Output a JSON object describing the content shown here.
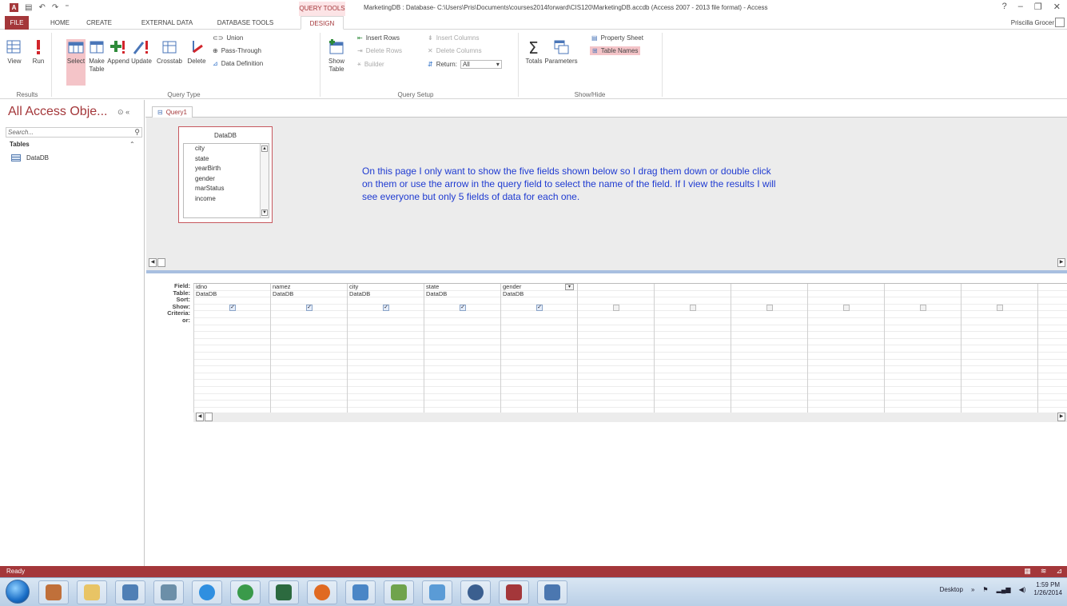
{
  "app": {
    "window_title": "MarketingDB : Database- C:\\Users\\Pris\\Documents\\courses2014forward\\CIS120\\MarketingDB.accdb (Access 2007 - 2013 file format) - Access",
    "contextual_tab": "QUERY TOOLS",
    "help": "?",
    "user": "Priscilla Grocer"
  },
  "tabs": [
    "FILE",
    "HOME",
    "CREATE",
    "EXTERNAL DATA",
    "DATABASE TOOLS",
    "DESIGN"
  ],
  "ribbon": {
    "results": {
      "view": "View",
      "run": "Run",
      "label": "Results"
    },
    "query_type": {
      "select": "Select",
      "make_table": "Make Table",
      "append": "Append",
      "update": "Update",
      "crosstab": "Crosstab",
      "delete": "Delete",
      "union": "Union",
      "pass_through": "Pass-Through",
      "data_definition": "Data Definition",
      "label": "Query Type"
    },
    "query_setup": {
      "show_table": "Show Table",
      "insert_rows": "Insert Rows",
      "delete_rows": "Delete Rows",
      "builder": "Builder",
      "insert_columns": "Insert Columns",
      "delete_columns": "Delete Columns",
      "return_label": "Return:",
      "return_value": "All",
      "label": "Query Setup"
    },
    "show_hide": {
      "totals": "Totals",
      "parameters": "Parameters",
      "property_sheet": "Property Sheet",
      "table_names": "Table Names",
      "label": "Show/Hide"
    }
  },
  "nav": {
    "title": "All Access Obje...",
    "search_placeholder": "Search...",
    "section": "Tables",
    "items": [
      "DataDB"
    ]
  },
  "document_tab": "Query1",
  "table_box": {
    "title": "DataDB",
    "fields": [
      "city",
      "state",
      "yearBirth",
      "gender",
      "marStatus",
      "income"
    ]
  },
  "annotation": "On this page I only want to show the five fields shown below so I drag them down or double click on them or use the arrow in the query field to select the name of the field.  If I view the results I will see everyone but only 5 fields of data for each one.",
  "grid": {
    "row_headers": [
      "Field:",
      "Table:",
      "Sort:",
      "Show:",
      "Criteria:",
      "or:"
    ],
    "columns": [
      {
        "field": "idno",
        "table": "DataDB",
        "show": true
      },
      {
        "field": "namez",
        "table": "DataDB",
        "show": true
      },
      {
        "field": "city",
        "table": "DataDB",
        "show": true
      },
      {
        "field": "state",
        "table": "DataDB",
        "show": true
      },
      {
        "field": "gender",
        "table": "DataDB",
        "show": true
      },
      {
        "field": "",
        "table": "",
        "show": false
      },
      {
        "field": "",
        "table": "",
        "show": false
      },
      {
        "field": "",
        "table": "",
        "show": false
      },
      {
        "field": "",
        "table": "",
        "show": false
      },
      {
        "field": "",
        "table": "",
        "show": false
      },
      {
        "field": "",
        "table": "",
        "show": false
      },
      {
        "field": "",
        "table": "",
        "show": false
      }
    ]
  },
  "status": {
    "text": "Ready"
  },
  "taskbar": {
    "desktop": "Desktop",
    "time": "1:59 PM",
    "date": "1/26/2014"
  },
  "colors": {
    "accent": "#a4373a",
    "annotation": "#1f3bd1",
    "ribbon_highlight": "#f4c4c8"
  }
}
